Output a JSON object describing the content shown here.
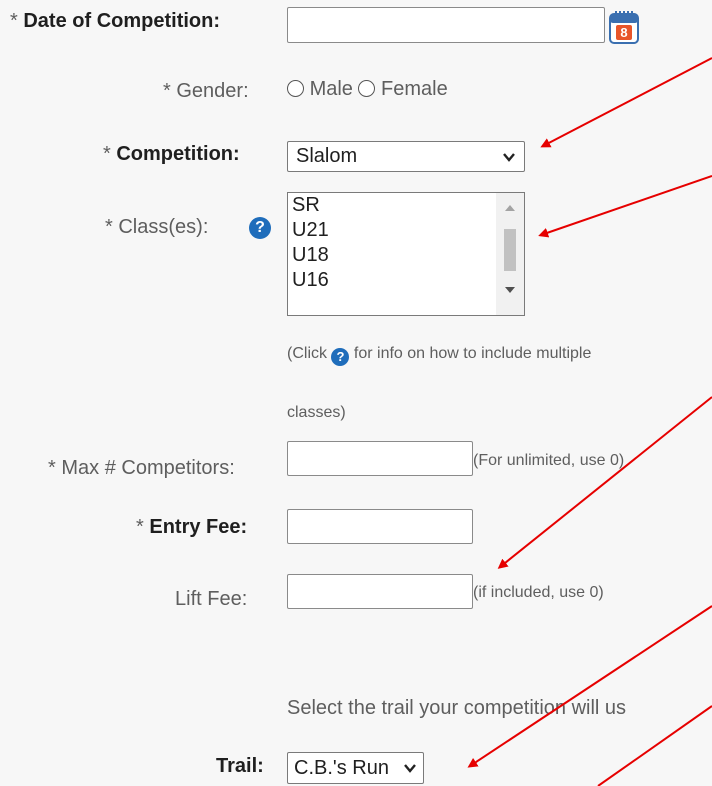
{
  "form": {
    "required_mark": "*",
    "date": {
      "label": "Date of Competition:",
      "value": "",
      "calendar_day": "8"
    },
    "gender": {
      "label": "Gender:",
      "options": [
        "Male",
        "Female"
      ]
    },
    "competition": {
      "label": "Competition:",
      "selected": "Slalom"
    },
    "classes": {
      "label": "Class(es):",
      "options": [
        "SR",
        "U21",
        "U18",
        "U16"
      ],
      "help_text_line1": "(Click",
      "help_text_line1b": "for info on how to include multiple",
      "help_text_line2": "classes)"
    },
    "max_competitors": {
      "label": "Max # Competitors:",
      "value": "",
      "hint": "(For unlimited, use 0)"
    },
    "entry_fee": {
      "label": "Entry Fee:",
      "value": ""
    },
    "lift_fee": {
      "label": "Lift Fee:",
      "value": "",
      "hint": "(if included, use 0)"
    },
    "trail_prompt": "Select the trail your competition will us",
    "trail": {
      "label": "Trail:",
      "selected": "C.B.'s Run"
    }
  },
  "colors": {
    "arrow": "#e60000",
    "help_icon": "#1f6dbb"
  }
}
